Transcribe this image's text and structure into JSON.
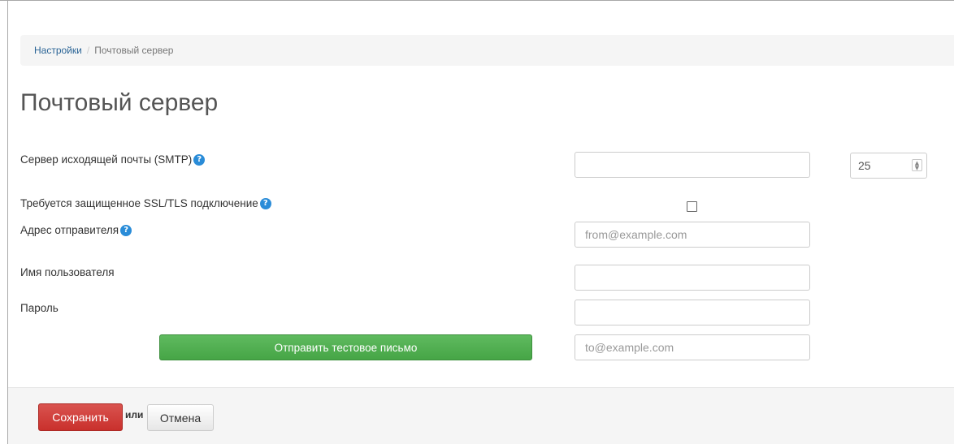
{
  "breadcrumb": {
    "parent": "Настройки",
    "separator": "/",
    "current": "Почтовый сервер"
  },
  "page_title": "Почтовый сервер",
  "form": {
    "smtp": {
      "label": "Сервер исходящей почты (SMTP)",
      "value": "",
      "port": "25"
    },
    "ssl": {
      "label": "Требуется защищенное SSL/TLS подключение",
      "checked": false
    },
    "sender": {
      "label": "Адрес отправителя",
      "value": "",
      "placeholder": "from@example.com"
    },
    "username": {
      "label": "Имя пользователя",
      "value": ""
    },
    "password": {
      "label": "Пароль",
      "value": ""
    },
    "test_email": {
      "button_label": "Отправить тестовое письмо",
      "value": "",
      "placeholder": "to@example.com"
    }
  },
  "footer": {
    "save_label": "Сохранить",
    "or_label": "или",
    "cancel_label": "Отмена"
  },
  "icons": {
    "help": "question-circle-icon",
    "spinner": "up-down-arrows-icon"
  },
  "colors": {
    "link": "#2a6496",
    "help_icon": "#2a8cd8",
    "success": "#46a546",
    "danger": "#c9302c"
  }
}
